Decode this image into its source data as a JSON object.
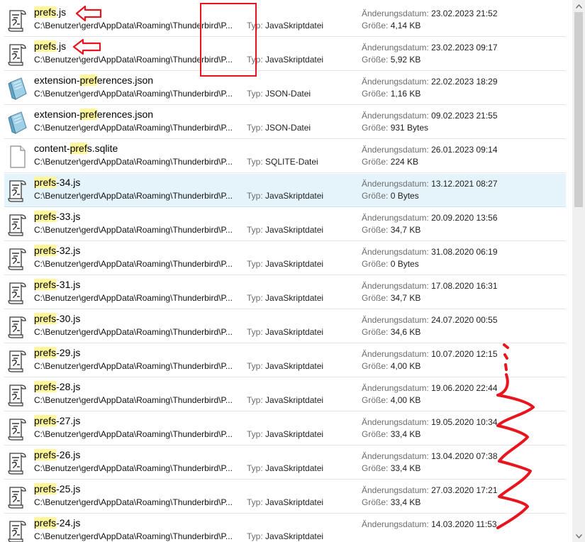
{
  "list": {
    "type_label": "Typ:",
    "date_label": "Änderungsdatum:",
    "size_label": "Größe:",
    "path": "C:\\Benutzer\\gerd\\AppData\\Roaming\\Thunderbird\\P...",
    "items": [
      {
        "pre": "",
        "hl": "prefs",
        "post": ".js",
        "type": "JavaSkriptdatei",
        "date": "23.02.2023 21:52",
        "size": "4,14 KB",
        "icon": "javascript-file-icon"
      },
      {
        "pre": "",
        "hl": "prefs",
        "post": ".js",
        "type": "JavaSkriptdatei",
        "date": "23.02.2023 09:17",
        "size": "5,92 KB",
        "icon": "javascript-file-icon"
      },
      {
        "pre": "extension-",
        "hl": "pref",
        "post": "erences.json",
        "type": "JSON-Datei",
        "date": "22.02.2023 18:29",
        "size": "1,16 KB",
        "icon": "json-file-icon"
      },
      {
        "pre": "extension-",
        "hl": "pref",
        "post": "erences.json",
        "type": "JSON-Datei",
        "date": "09.02.2023 21:55",
        "size": "931 Bytes",
        "icon": "json-file-icon"
      },
      {
        "pre": "content-",
        "hl": "pref",
        "post": "s.sqlite",
        "type": "SQLITE-Datei",
        "date": "26.01.2023 09:14",
        "size": "224 KB",
        "icon": "blank-file-icon"
      },
      {
        "pre": "",
        "hl": "prefs",
        "post": "-34.js",
        "type": "JavaSkriptdatei",
        "date": "13.12.2021 08:27",
        "size": "0 Bytes",
        "icon": "javascript-file-icon",
        "selected": true
      },
      {
        "pre": "",
        "hl": "prefs",
        "post": "-33.js",
        "type": "JavaSkriptdatei",
        "date": "20.09.2020 13:56",
        "size": "34,7 KB",
        "icon": "javascript-file-icon"
      },
      {
        "pre": "",
        "hl": "prefs",
        "post": "-32.js",
        "type": "JavaSkriptdatei",
        "date": "31.08.2020 06:19",
        "size": "0 Bytes",
        "icon": "javascript-file-icon"
      },
      {
        "pre": "",
        "hl": "prefs",
        "post": "-31.js",
        "type": "JavaSkriptdatei",
        "date": "17.08.2020 16:31",
        "size": "34,7 KB",
        "icon": "javascript-file-icon"
      },
      {
        "pre": "",
        "hl": "prefs",
        "post": "-30.js",
        "type": "JavaSkriptdatei",
        "date": "24.07.2020 00:55",
        "size": "34,6 KB",
        "icon": "javascript-file-icon"
      },
      {
        "pre": "",
        "hl": "prefs",
        "post": "-29.js",
        "type": "JavaSkriptdatei",
        "date": "10.07.2020 12:15",
        "size": "4,00 KB",
        "icon": "javascript-file-icon"
      },
      {
        "pre": "",
        "hl": "prefs",
        "post": "-28.js",
        "type": "JavaSkriptdatei",
        "date": "19.06.2020 22:44",
        "size": "4,00 KB",
        "icon": "javascript-file-icon"
      },
      {
        "pre": "",
        "hl": "prefs",
        "post": "-27.js",
        "type": "JavaSkriptdatei",
        "date": "19.05.2020 10:34",
        "size": "33,4 KB",
        "icon": "javascript-file-icon"
      },
      {
        "pre": "",
        "hl": "prefs",
        "post": "-26.js",
        "type": "JavaSkriptdatei",
        "date": "13.04.2020 07:38",
        "size": "33,4 KB",
        "icon": "javascript-file-icon"
      },
      {
        "pre": "",
        "hl": "prefs",
        "post": "-25.js",
        "type": "JavaSkriptdatei",
        "date": "27.03.2020 17:21",
        "size": "33,4 KB",
        "icon": "javascript-file-icon"
      },
      {
        "pre": "",
        "hl": "prefs",
        "post": "-24.js",
        "type": "JavaSkriptdatei",
        "date": "14.03.2020 11:53",
        "size": "",
        "icon": "javascript-file-icon"
      }
    ]
  },
  "colors": {
    "highlight": "#fff799",
    "selected_row": "#e5f3fb",
    "annotation_red": "#e8141e"
  },
  "scrollbar": {
    "up_icon": "chevron-up-icon",
    "down_icon": "chevron-down-icon"
  }
}
